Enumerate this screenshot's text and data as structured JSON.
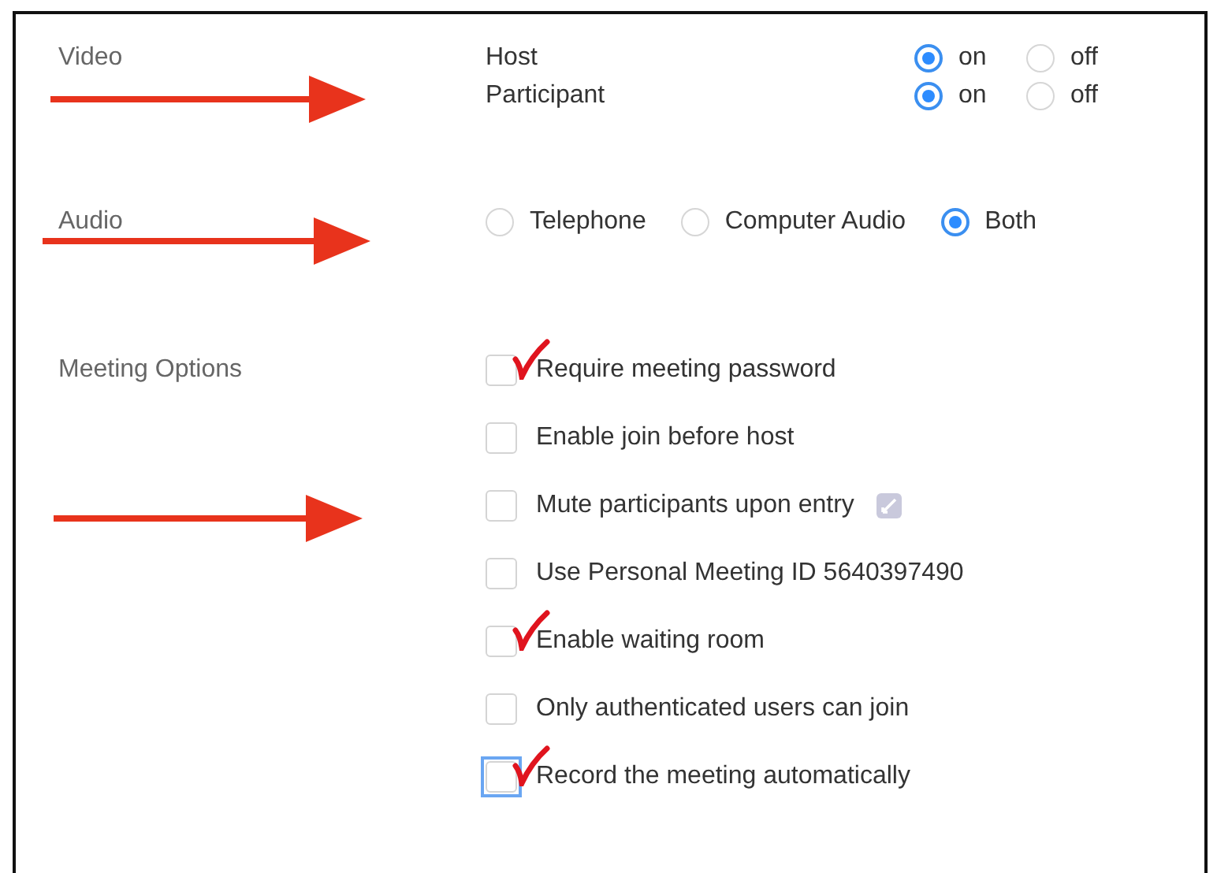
{
  "sections": [
    {
      "kind": "radio-grid",
      "label": "Video",
      "arrow": true,
      "rows": [
        {
          "label": "Host",
          "options": [
            {
              "label": "on",
              "selected": true
            },
            {
              "label": "off",
              "selected": false
            }
          ]
        },
        {
          "label": "Participant",
          "options": [
            {
              "label": "on",
              "selected": true
            },
            {
              "label": "off",
              "selected": false
            }
          ]
        }
      ]
    },
    {
      "kind": "radio-row",
      "label": "Audio",
      "arrow": true,
      "options": [
        {
          "label": "Telephone",
          "selected": false
        },
        {
          "label": "Computer Audio",
          "selected": false
        },
        {
          "label": "Both",
          "selected": true
        }
      ]
    },
    {
      "kind": "checklist",
      "label": "Meeting Options",
      "arrow": true,
      "items": [
        {
          "label": "Require meeting password",
          "checked": false,
          "focused": false,
          "hand_tick": true,
          "info_icon": false
        },
        {
          "label": "Enable join before host",
          "checked": false,
          "focused": false,
          "hand_tick": false,
          "info_icon": false
        },
        {
          "label": "Mute participants upon entry",
          "checked": false,
          "focused": false,
          "hand_tick": false,
          "info_icon": true
        },
        {
          "label": "Use Personal Meeting ID 5640397490",
          "checked": false,
          "focused": false,
          "hand_tick": false,
          "info_icon": false
        },
        {
          "label": "Enable waiting room",
          "checked": false,
          "focused": false,
          "hand_tick": true,
          "info_icon": false
        },
        {
          "label": "Only authenticated users can join",
          "checked": false,
          "focused": false,
          "hand_tick": false,
          "info_icon": false
        },
        {
          "label": "Record the meeting automatically",
          "checked": false,
          "focused": true,
          "hand_tick": true,
          "info_icon": false
        }
      ]
    }
  ]
}
